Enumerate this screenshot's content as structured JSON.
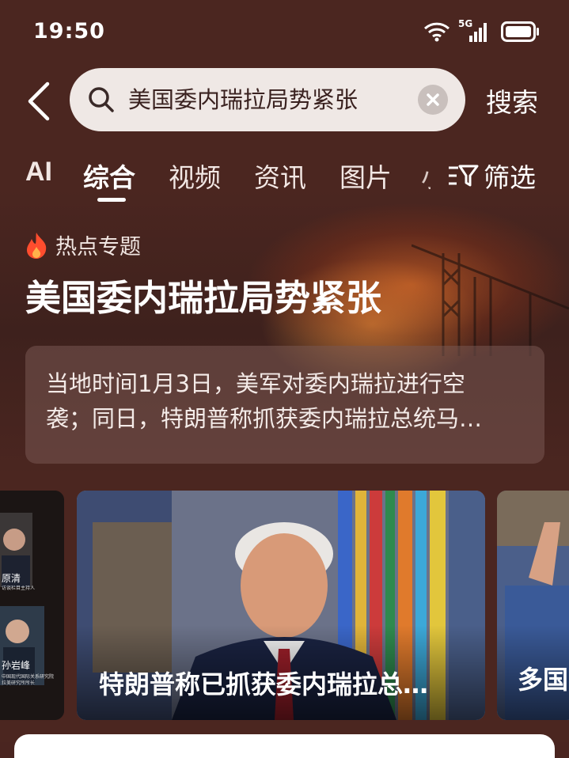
{
  "status_bar": {
    "time": "19:50",
    "network": "5G",
    "icons": [
      "wifi-icon",
      "signal-icon",
      "battery-icon"
    ]
  },
  "search": {
    "query": "美国委内瑞拉局势紧张",
    "button_label": "搜索"
  },
  "tabs": [
    {
      "label": "AI"
    },
    {
      "label": "综合",
      "active": true
    },
    {
      "label": "视频"
    },
    {
      "label": "资讯"
    },
    {
      "label": "图片"
    },
    {
      "label": "小"
    }
  ],
  "filter_label": "筛选",
  "hot_topic": {
    "label": "热点专题",
    "title": "美国委内瑞拉局势紧张",
    "summary_line1": "当地时间1月3日，美军对委内瑞拉进行空",
    "summary_line2": "袭；同日，特朗普称抓获委内瑞拉总统马…"
  },
  "cards": {
    "left": {
      "person1_name": "原清",
      "person1_title": "访谈栏目主持人",
      "person2_name": "孙岩峰",
      "person2_title": "中国现代国际关系研究院拉美研究所所长"
    },
    "main_caption": "特朗普称已抓获委内瑞拉总…",
    "right_caption": "多国"
  },
  "colors": {
    "background": "#4a2520",
    "search_box": "#efe8e5",
    "accent_fire": "#ff5a2a"
  }
}
